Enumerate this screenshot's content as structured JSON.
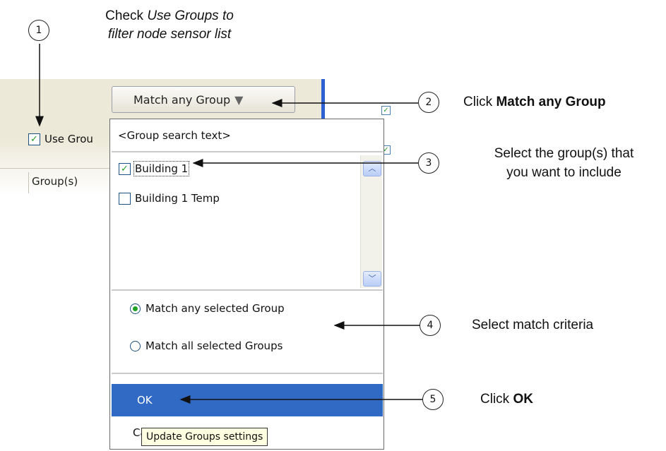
{
  "app": {
    "match_button_label": "Match any Group",
    "use_groups_label": "Use Grou",
    "use_groups_checked": true,
    "column_header": "Group(s)"
  },
  "dropdown": {
    "search_placeholder": "<Group search text>",
    "groups": [
      {
        "label": "Building 1",
        "checked": true,
        "focused": true
      },
      {
        "label": "Building 1 Temp",
        "checked": false,
        "focused": false
      }
    ],
    "match_options": [
      {
        "label": "Match any selected Group",
        "selected": true
      },
      {
        "label": "Match all selected Groups",
        "selected": false
      }
    ],
    "ok_label": "OK",
    "cancel_label": "Can",
    "tooltip": "Update Groups settings"
  },
  "callouts": [
    {
      "number": "1",
      "line1_prefix": "Check ",
      "line1_em": "Use Groups",
      "line1_suffix": " to",
      "line2": "filter node sensor list"
    },
    {
      "number": "2",
      "prefix": "Click ",
      "bold": "Match any Group"
    },
    {
      "number": "3",
      "line1": "Select the group(s) that",
      "line2": "you want to include"
    },
    {
      "number": "4",
      "text": "Select match criteria"
    },
    {
      "number": "5",
      "prefix": "Click ",
      "bold": "OK"
    }
  ],
  "colors": {
    "panel_bg": "#ece9d8",
    "selection_blue": "#316ac5",
    "check_green": "#21a121",
    "tooltip_bg": "#ffffe1"
  }
}
